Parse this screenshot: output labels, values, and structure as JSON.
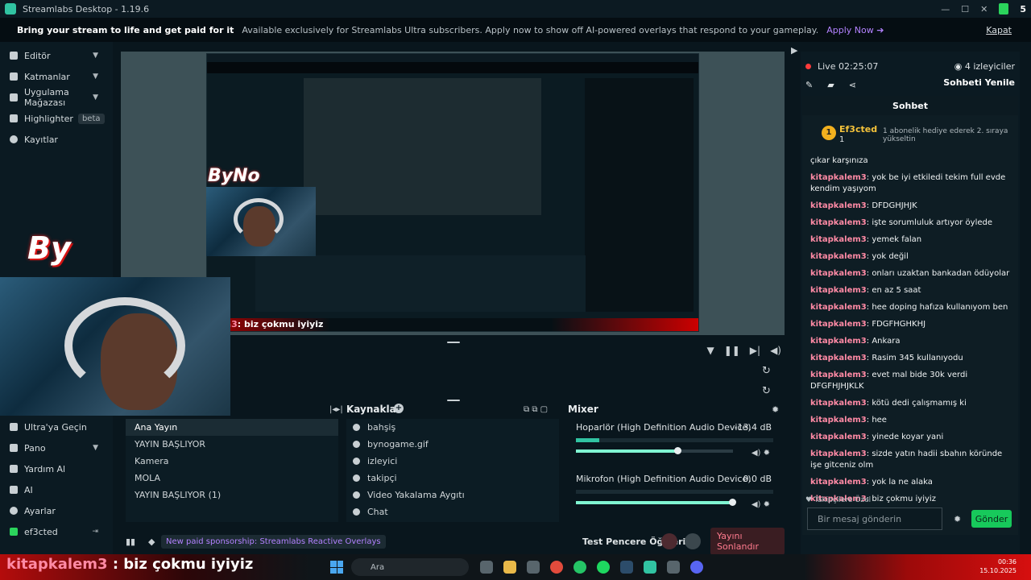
{
  "window": {
    "title": "Streamlabs Desktop - 1.19.6",
    "ultra_count": "5"
  },
  "banner": {
    "headline": "Bring your stream to life and get paid for it",
    "text": "Available exclusively for Streamlabs Ultra subscribers. Apply now to show off AI-powered overlays that respond to your gameplay.",
    "cta": "Apply Now ➔",
    "close": "Kapat"
  },
  "sidebar": {
    "top_items": [
      {
        "label": "Editör"
      },
      {
        "label": "Katmanlar"
      },
      {
        "label": "Uygulama Mağazası"
      },
      {
        "label": "Highlighter",
        "badge": "beta"
      },
      {
        "label": "Kayıtlar"
      }
    ],
    "bottom_items": [
      {
        "label": "Ultra'ya Geçin"
      },
      {
        "label": "Pano"
      },
      {
        "label": "Yardım Al"
      },
      {
        "label": "AI"
      },
      {
        "label": "Ayarlar"
      },
      {
        "label": "ef3cted"
      }
    ]
  },
  "preview": {
    "overlay_logo": "By",
    "nested_logo": "ByNo",
    "nested_chat_user": "alem3",
    "nested_chat_text": ": biz çokmu iyiyiz"
  },
  "scenes": {
    "title": "",
    "items": [
      "Ana Yayın",
      "YAYIN BAŞLIYOR",
      "Kamera",
      "MOLA",
      "YAYIN BAŞLIYOR (1)"
    ],
    "active_index": 0
  },
  "sources": {
    "title": "Kaynaklar",
    "items": [
      "bahşiş",
      "bynogame.gif",
      "izleyici",
      "takipçi",
      "Video Yakalama Aygıtı",
      "Chat"
    ]
  },
  "mixer": {
    "title": "Mixer",
    "channels": [
      {
        "name": "Hoparlör (High Definition Audio Device)",
        "db": "-13.4 dB",
        "level": 0.12,
        "volume": 0.65
      },
      {
        "name": "Mikrofon (High Definition Audio Device)",
        "db": "0.0 dB",
        "level": 0.0,
        "volume": 1.0
      }
    ]
  },
  "footer": {
    "notice": "New paid sponsorship: Streamlabs Reactive Overlays",
    "test_label": "Test Pencere Öğeleri",
    "end_stream": "Yayını Sonlandır"
  },
  "live": {
    "status": "Live 02:25:07",
    "viewers": "4 izleyiciler",
    "refresh": "Sohbeti Yenile"
  },
  "chat": {
    "title": "Sohbet",
    "gift": {
      "rank": "1",
      "name": "Ef3cted",
      "count": "1",
      "message": "1 abonelik hediye ederek 2. sıraya yükseltin"
    },
    "messages": [
      {
        "user": "",
        "text": "çıkar karşınıza"
      },
      {
        "user": "kitapkalem3",
        "text": ": yok be iyi etkiledi tekim full evde kendim yaşıyom"
      },
      {
        "user": "kitapkalem3",
        "text": ": DFDGHJHJK"
      },
      {
        "user": "kitapkalem3",
        "text": ": işte sorumluluk artıyor öylede"
      },
      {
        "user": "kitapkalem3",
        "text": ": yemek falan"
      },
      {
        "user": "kitapkalem3",
        "text": ": yok değil"
      },
      {
        "user": "kitapkalem3",
        "text": ": onları uzaktan bankadan ödüyolar"
      },
      {
        "user": "kitapkalem3",
        "text": ": en az 5 saat"
      },
      {
        "user": "kitapkalem3",
        "text": ": hee doping hafıza kullanıyom ben"
      },
      {
        "user": "kitapkalem3",
        "text": ": FDGFHGHKHJ"
      },
      {
        "user": "kitapkalem3",
        "text": ": Ankara"
      },
      {
        "user": "kitapkalem3",
        "text": ": Rasim 345 kullanıyodu"
      },
      {
        "user": "kitapkalem3",
        "text": ": evet mal bide 30k verdi DFGFHJHJKLK"
      },
      {
        "user": "kitapkalem3",
        "text": ": kötü dedi çalışmamış ki"
      },
      {
        "user": "kitapkalem3",
        "text": ": hee"
      },
      {
        "user": "kitapkalem3",
        "text": ": yinede koyar yani"
      },
      {
        "user": "kitapkalem3",
        "text": ": sizde yatın hadii sbahın köründe işe gitceniz olm"
      },
      {
        "user": "kitapkalem3",
        "text": ": yok la ne alaka"
      },
      {
        "user": "kitapkalem3",
        "text": ": biz çokmu iyiyiz"
      }
    ],
    "follower_only": "Takipçilere Özel",
    "input_placeholder": "Bir mesaj gönderin",
    "send": "Gönder"
  },
  "overlay_chat": {
    "user": "kitapkalem3",
    "text": " : biz çokmu iyiyiz"
  },
  "taskbar": {
    "search": "Ara",
    "time": "00:36",
    "date": "15.10.2025"
  },
  "colors": {
    "accent": "#31c3a2",
    "send": "#17c95b",
    "user": "#ff8aa5",
    "sponsor": "#b382ff"
  }
}
